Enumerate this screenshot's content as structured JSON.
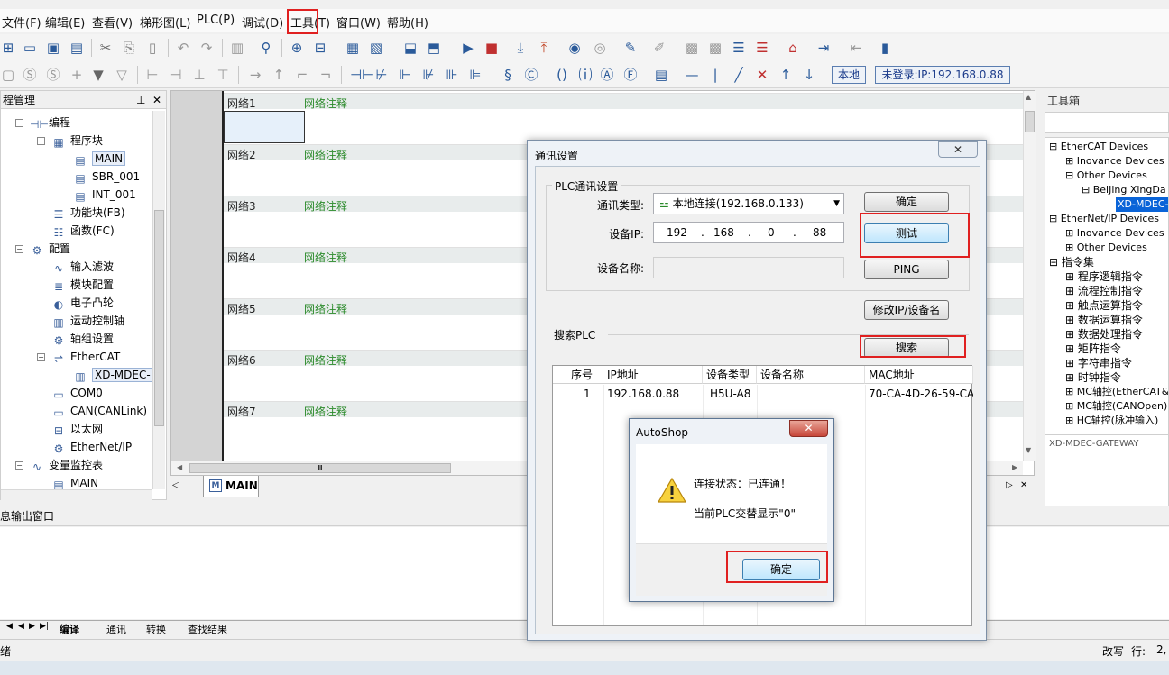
{
  "menu": [
    "文件(F)",
    "编辑(E)",
    "查看(V)",
    "梯形图(L)",
    "PLC(P)",
    "调试(D)",
    "工具(T)",
    "窗口(W)",
    "帮助(H)"
  ],
  "toolbar": {
    "mode_label": "本地",
    "login_status": "未登录:IP:192.168.0.88"
  },
  "project_panel": {
    "title": "程管理",
    "items": [
      "编程",
      "程序块",
      "MAIN",
      "SBR_001",
      "INT_001",
      "功能块(FB)",
      "函数(FC)",
      "配置",
      "输入滤波",
      "模块配置",
      "电子凸轮",
      "运动控制轴",
      "轴组设置",
      "EtherCAT",
      "XD-MDEC-",
      "COM0",
      "CAN(CANLink)",
      "以太网",
      "EtherNet/IP",
      "变量监控表",
      "MAIN"
    ]
  },
  "editor": {
    "networks": [
      {
        "label": "网络1",
        "comment": "网络注释"
      },
      {
        "label": "网络2",
        "comment": "网络注释"
      },
      {
        "label": "网络3",
        "comment": "网络注释"
      },
      {
        "label": "网络4",
        "comment": "网络注释"
      },
      {
        "label": "网络5",
        "comment": "网络注释"
      },
      {
        "label": "网络6",
        "comment": "网络注释"
      },
      {
        "label": "网络7",
        "comment": "网络注释"
      }
    ],
    "tab": "MAIN",
    "hscroll_mark": "Ⅲ"
  },
  "toolbox": {
    "title": "工具箱",
    "tree": [
      "EtherCAT Devices",
      "Inovance Devices",
      "Other Devices",
      "BeiJing XingDa E",
      "XD-MDEC-G",
      "EtherNet/IP Devices",
      "Inovance Devices",
      "Other Devices",
      "指令集",
      "程序逻辑指令",
      "流程控制指令",
      "触点运算指令",
      "数据运算指令",
      "数据处理指令",
      "矩阵指令",
      "字符串指令",
      "时钟指令",
      "MC轴控(EtherCAT&",
      "MC轴控(CANOpen)",
      "HC轴控(脉冲输入)"
    ],
    "description": "XD-MDEC-GATEWAY"
  },
  "output": {
    "title": "息输出窗口",
    "tabs": [
      "编译",
      "通讯",
      "转换",
      "查找结果"
    ]
  },
  "status": {
    "left": "绪",
    "mode": "改写",
    "row_label": "行:",
    "row_value": "2,"
  },
  "comm_dialog": {
    "title": "通讯设置",
    "close": "✕",
    "group_label": "PLC通讯设置",
    "type_label": "通讯类型:",
    "type_value": "本地连接(192.168.0.133)",
    "ip_label": "设备IP:",
    "ip_octets": [
      "192",
      "168",
      "0",
      "88"
    ],
    "name_label": "设备名称:",
    "ok_button": "确定",
    "test_button": "测试",
    "ping_button": "PING",
    "modify_button": "修改IP/设备名",
    "search_group": "搜索PLC",
    "search_button": "搜索",
    "table": {
      "headers": [
        "序号",
        "IP地址",
        "设备类型",
        "设备名称",
        "MAC地址"
      ],
      "rows": [
        [
          "1",
          "192.168.0.88",
          "H5U-A8",
          "",
          "70-CA-4D-26-59-CA"
        ]
      ]
    }
  },
  "message_box": {
    "title": "AutoShop",
    "close": "✕",
    "line1": "连接状态：已连通！",
    "line2": "当前PLC交替显示\"0\"",
    "ok_button": "确定"
  },
  "highlight_color": "#e02020"
}
